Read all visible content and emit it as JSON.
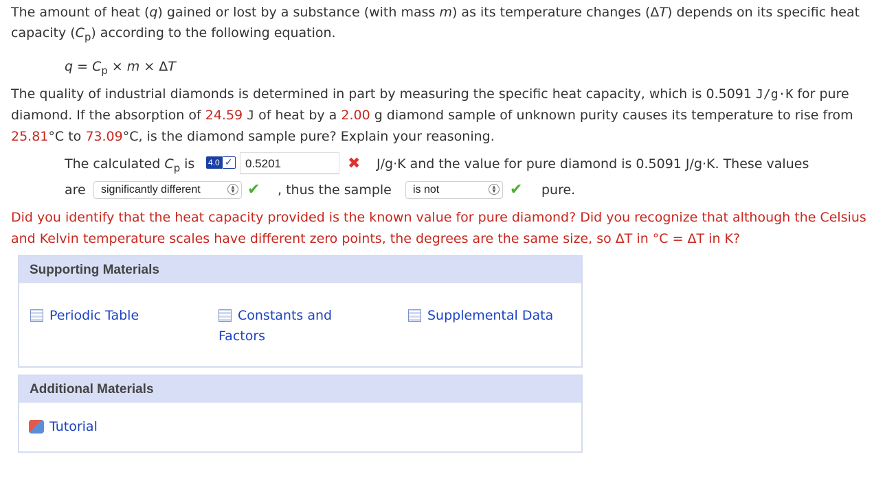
{
  "intro": {
    "line1_a": "The amount of heat (",
    "q": "q",
    "line1_b": ") gained or lost by a substance (with mass ",
    "m": "m",
    "line1_c": ") as its temperature changes (Δ",
    "T": "T",
    "line1_d": ") depends on its specific heat capacity (",
    "C": "C",
    "p": "p",
    "line1_e": ") according to the following equation."
  },
  "equation": {
    "q": "q",
    "eq": " = ",
    "C": "C",
    "p": "p",
    "rest_a": " × ",
    "m": "m",
    "rest_b": " × Δ",
    "T": "T"
  },
  "problem": {
    "a": "The quality of industrial diamonds is determined in part by measuring the specific heat capacity, which is 0.5091 ",
    "unit": "J/g·K",
    "b": " for pure diamond. If the absorption of ",
    "heat": "24.59",
    "c": " ",
    "J": "J",
    "d": " of heat by a ",
    "mass": "2.00",
    "e": " g diamond sample of unknown purity causes its temperature to rise from ",
    "t1": "25.81",
    "f": "°C to ",
    "t2": "73.09",
    "g": "°C, is the diamond sample pure? Explain your reasoning."
  },
  "answer": {
    "calc_label": "The calculated ",
    "C": "C",
    "p": "p",
    "is": " is",
    "badge_num": "4.0",
    "badge_check": "✓",
    "value": "0.5201",
    "x_mark": "✖",
    "after_value": "J/g·K and the value for pure diamond is 0.5091 J/g·K. These values",
    "are": "are",
    "select1": "significantly different",
    "check1": "✔",
    "thus": ", thus the sample",
    "select2": "is not",
    "check2": "✔",
    "pure": "pure."
  },
  "feedback": "Did you identify that the heat capacity provided is the known value for pure diamond? Did you recognize that although the Celsius and Kelvin temperature scales have different zero points, the degrees are the same size, so ΔT in °C = ΔT in K?",
  "supporting": {
    "title": "Supporting Materials",
    "links": [
      "Periodic Table",
      "Constants and Factors",
      "Supplemental Data"
    ]
  },
  "additional": {
    "title": "Additional Materials",
    "links": [
      "Tutorial"
    ]
  },
  "colors": {
    "accent_red": "#c8271e",
    "link_blue": "#1a43c2",
    "panel_header": "#d8def5",
    "check_green": "#4caf2e"
  }
}
